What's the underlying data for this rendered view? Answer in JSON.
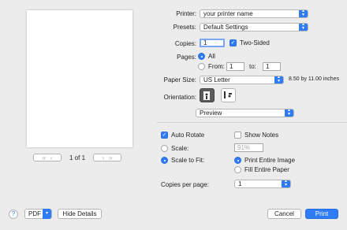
{
  "printer": {
    "label": "Printer:",
    "value": "your printer name"
  },
  "presets": {
    "label": "Presets:",
    "value": "Default Settings"
  },
  "copies": {
    "label": "Copies:",
    "value": "1",
    "two_sided": "Two-Sided"
  },
  "pages": {
    "label": "Pages:",
    "all": "All",
    "from_label": "From:",
    "from_value": "1",
    "to_label": "to:",
    "to_value": "1"
  },
  "paper_size": {
    "label": "Paper Size:",
    "value": "US Letter",
    "dimensions": "8.50 by 11.00 inches"
  },
  "orientation": {
    "label": "Orientation:"
  },
  "section": {
    "value": "Preview"
  },
  "preview_options": {
    "auto_rotate": "Auto Rotate",
    "show_notes": "Show Notes",
    "scale_label": "Scale:",
    "scale_value": "91%",
    "scale_to_fit": "Scale to Fit:",
    "print_entire_image": "Print Entire Image",
    "fill_entire_paper": "Fill Entire Paper",
    "copies_per_page_label": "Copies per page:",
    "copies_per_page_value": "1"
  },
  "preview": {
    "page_indicator": "1 of 1"
  },
  "footer": {
    "help": "?",
    "pdf": "PDF",
    "hide_details": "Hide Details",
    "cancel": "Cancel",
    "print": "Print"
  },
  "colors": {
    "accent": "#2f7cf6",
    "background": "#ececec"
  }
}
